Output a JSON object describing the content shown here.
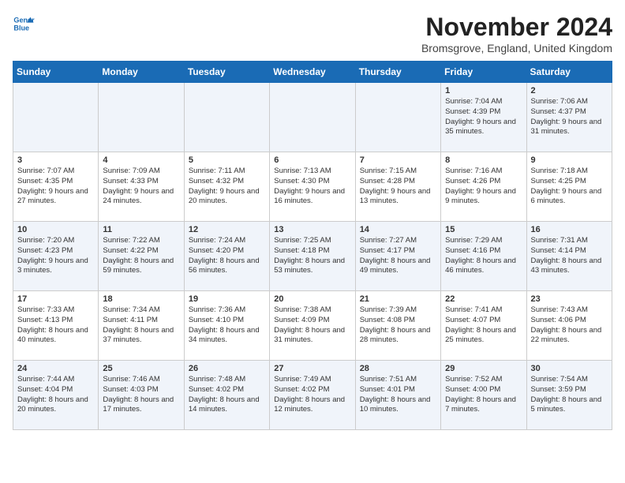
{
  "logo": {
    "line1": "General",
    "line2": "Blue"
  },
  "title": "November 2024",
  "location": "Bromsgrove, England, United Kingdom",
  "weekdays": [
    "Sunday",
    "Monday",
    "Tuesday",
    "Wednesday",
    "Thursday",
    "Friday",
    "Saturday"
  ],
  "weeks": [
    [
      {
        "day": "",
        "content": ""
      },
      {
        "day": "",
        "content": ""
      },
      {
        "day": "",
        "content": ""
      },
      {
        "day": "",
        "content": ""
      },
      {
        "day": "",
        "content": ""
      },
      {
        "day": "1",
        "content": "Sunrise: 7:04 AM\nSunset: 4:39 PM\nDaylight: 9 hours\nand 35 minutes."
      },
      {
        "day": "2",
        "content": "Sunrise: 7:06 AM\nSunset: 4:37 PM\nDaylight: 9 hours\nand 31 minutes."
      }
    ],
    [
      {
        "day": "3",
        "content": "Sunrise: 7:07 AM\nSunset: 4:35 PM\nDaylight: 9 hours\nand 27 minutes."
      },
      {
        "day": "4",
        "content": "Sunrise: 7:09 AM\nSunset: 4:33 PM\nDaylight: 9 hours\nand 24 minutes."
      },
      {
        "day": "5",
        "content": "Sunrise: 7:11 AM\nSunset: 4:32 PM\nDaylight: 9 hours\nand 20 minutes."
      },
      {
        "day": "6",
        "content": "Sunrise: 7:13 AM\nSunset: 4:30 PM\nDaylight: 9 hours\nand 16 minutes."
      },
      {
        "day": "7",
        "content": "Sunrise: 7:15 AM\nSunset: 4:28 PM\nDaylight: 9 hours\nand 13 minutes."
      },
      {
        "day": "8",
        "content": "Sunrise: 7:16 AM\nSunset: 4:26 PM\nDaylight: 9 hours\nand 9 minutes."
      },
      {
        "day": "9",
        "content": "Sunrise: 7:18 AM\nSunset: 4:25 PM\nDaylight: 9 hours\nand 6 minutes."
      }
    ],
    [
      {
        "day": "10",
        "content": "Sunrise: 7:20 AM\nSunset: 4:23 PM\nDaylight: 9 hours\nand 3 minutes."
      },
      {
        "day": "11",
        "content": "Sunrise: 7:22 AM\nSunset: 4:22 PM\nDaylight: 8 hours\nand 59 minutes."
      },
      {
        "day": "12",
        "content": "Sunrise: 7:24 AM\nSunset: 4:20 PM\nDaylight: 8 hours\nand 56 minutes."
      },
      {
        "day": "13",
        "content": "Sunrise: 7:25 AM\nSunset: 4:18 PM\nDaylight: 8 hours\nand 53 minutes."
      },
      {
        "day": "14",
        "content": "Sunrise: 7:27 AM\nSunset: 4:17 PM\nDaylight: 8 hours\nand 49 minutes."
      },
      {
        "day": "15",
        "content": "Sunrise: 7:29 AM\nSunset: 4:16 PM\nDaylight: 8 hours\nand 46 minutes."
      },
      {
        "day": "16",
        "content": "Sunrise: 7:31 AM\nSunset: 4:14 PM\nDaylight: 8 hours\nand 43 minutes."
      }
    ],
    [
      {
        "day": "17",
        "content": "Sunrise: 7:33 AM\nSunset: 4:13 PM\nDaylight: 8 hours\nand 40 minutes."
      },
      {
        "day": "18",
        "content": "Sunrise: 7:34 AM\nSunset: 4:11 PM\nDaylight: 8 hours\nand 37 minutes."
      },
      {
        "day": "19",
        "content": "Sunrise: 7:36 AM\nSunset: 4:10 PM\nDaylight: 8 hours\nand 34 minutes."
      },
      {
        "day": "20",
        "content": "Sunrise: 7:38 AM\nSunset: 4:09 PM\nDaylight: 8 hours\nand 31 minutes."
      },
      {
        "day": "21",
        "content": "Sunrise: 7:39 AM\nSunset: 4:08 PM\nDaylight: 8 hours\nand 28 minutes."
      },
      {
        "day": "22",
        "content": "Sunrise: 7:41 AM\nSunset: 4:07 PM\nDaylight: 8 hours\nand 25 minutes."
      },
      {
        "day": "23",
        "content": "Sunrise: 7:43 AM\nSunset: 4:06 PM\nDaylight: 8 hours\nand 22 minutes."
      }
    ],
    [
      {
        "day": "24",
        "content": "Sunrise: 7:44 AM\nSunset: 4:04 PM\nDaylight: 8 hours\nand 20 minutes."
      },
      {
        "day": "25",
        "content": "Sunrise: 7:46 AM\nSunset: 4:03 PM\nDaylight: 8 hours\nand 17 minutes."
      },
      {
        "day": "26",
        "content": "Sunrise: 7:48 AM\nSunset: 4:02 PM\nDaylight: 8 hours\nand 14 minutes."
      },
      {
        "day": "27",
        "content": "Sunrise: 7:49 AM\nSunset: 4:02 PM\nDaylight: 8 hours\nand 12 minutes."
      },
      {
        "day": "28",
        "content": "Sunrise: 7:51 AM\nSunset: 4:01 PM\nDaylight: 8 hours\nand 10 minutes."
      },
      {
        "day": "29",
        "content": "Sunrise: 7:52 AM\nSunset: 4:00 PM\nDaylight: 8 hours\nand 7 minutes."
      },
      {
        "day": "30",
        "content": "Sunrise: 7:54 AM\nSunset: 3:59 PM\nDaylight: 8 hours\nand 5 minutes."
      }
    ]
  ]
}
